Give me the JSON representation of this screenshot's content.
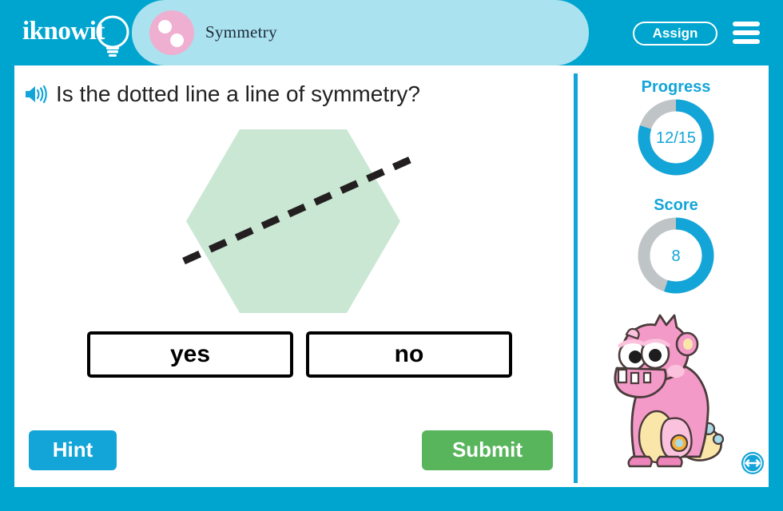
{
  "header": {
    "logo_text": "iknowit",
    "logo_icon": "lightbulb-icon",
    "subject_icon": "two-dots-circle-icon",
    "subject_title": "Symmetry",
    "assign_label": "Assign",
    "menu_icon": "hamburger-menu-icon",
    "bg_color": "#00a5cf",
    "tab_color": "#abe2ef",
    "subject_icon_color": "#efafd0"
  },
  "question": {
    "speaker_icon": "speaker-audio-icon",
    "text": "Is the dotted line a line of symmetry?"
  },
  "figure": {
    "shape": "hexagon",
    "shape_fill": "#cae7d4",
    "line_style": "dashed",
    "line_color": "#231f20",
    "line_width": 9,
    "description": "Light green hexagon crossed by a thick black dashed diagonal line"
  },
  "answers": [
    {
      "id": "yes",
      "label": "yes"
    },
    {
      "id": "no",
      "label": "no"
    }
  ],
  "actions": {
    "hint_label": "Hint",
    "hint_color": "#13a5d8",
    "submit_label": "Submit",
    "submit_color": "#58b55c"
  },
  "panel": {
    "progress": {
      "label": "Progress",
      "value": "12/15",
      "percent": 80,
      "fill_color": "#13a5d8",
      "track_color": "#bfc4c6"
    },
    "score": {
      "label": "Score",
      "value": "8",
      "percent": 55,
      "fill_color": "#13a5d8",
      "track_color": "#bfc4c6"
    },
    "mascot_icon": "pink-monster-mascot",
    "resize_icon": "horizontal-resize-arrow-icon"
  }
}
